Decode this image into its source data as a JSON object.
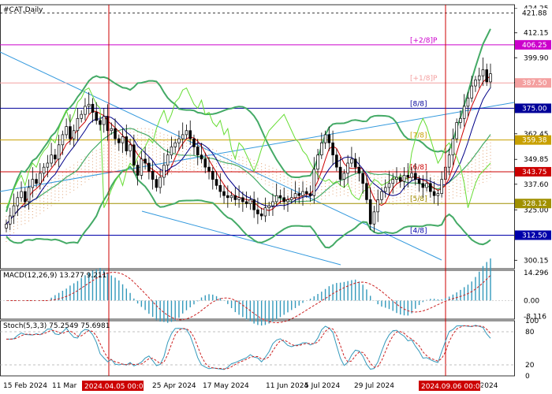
{
  "title": "#CAT,Daily",
  "chart_data": {
    "type": "candlestick",
    "symbol": "#CAT",
    "timeframe": "Daily",
    "price_axis_ticks": [
      "424.25",
      "412.15",
      "399.90",
      "387.70",
      "362.45",
      "349.85",
      "337.60",
      "325.00",
      "300.15"
    ],
    "price_range": [
      296,
      426
    ],
    "date_axis_labels": [
      "15 Feb 2024",
      "11 Mar",
      "25 Apr 2024",
      "17 May 2024",
      "11 Jun 2024",
      "5 Jul 2024",
      "29 Jul 2024",
      "p 2024"
    ],
    "highlighted_dates": [
      "2024.04.05 00:00",
      "2024.09.06 00:00"
    ],
    "murrey_levels": [
      {
        "label": "[+2/8]P",
        "price": 406.25,
        "tag": "406.25",
        "color": "#cc00cc"
      },
      {
        "label": "[+1/8]P",
        "price": 387.5,
        "tag": "387.50",
        "color": "#f4a0a0"
      },
      {
        "label": "[8/8]",
        "price": 375.0,
        "tag": "375.00",
        "color": "#000099"
      },
      {
        "label": "[7/8]",
        "price": 359.38,
        "tag": "359.38",
        "color": "#c8a000"
      },
      {
        "label": "[6/8]",
        "price": 343.75,
        "tag": "343.75",
        "color": "#cc0000"
      },
      {
        "label": "[5/8]",
        "price": 328.12,
        "tag": "328.12",
        "color": "#a09000"
      },
      {
        "label": "[4/8]",
        "price": 312.5,
        "tag": "312.50",
        "color": "#0000aa"
      }
    ],
    "top_level": {
      "price": 421.88,
      "tag": "421.88"
    },
    "last_price": 387.7,
    "close": [
      318,
      322,
      327,
      331,
      334,
      329,
      336,
      340,
      338,
      343,
      346,
      348,
      352,
      350,
      357,
      362,
      366,
      360,
      364,
      370,
      372,
      376,
      377,
      373,
      369,
      367,
      371,
      364,
      365,
      360,
      358,
      361,
      354,
      357,
      347,
      342,
      350,
      348,
      344,
      340,
      336,
      341,
      347,
      352,
      356,
      358,
      360,
      362,
      364,
      360,
      356,
      352,
      350,
      346,
      344,
      340,
      337,
      334,
      332,
      331,
      332,
      330,
      331,
      329,
      328,
      330,
      325,
      323,
      322,
      326,
      327,
      329,
      332,
      331,
      329,
      330,
      331,
      333,
      332,
      334,
      333,
      332,
      345,
      352,
      358,
      362,
      358,
      352,
      346,
      340,
      343,
      348,
      350,
      346,
      343,
      338,
      330,
      318,
      324,
      330,
      334,
      336,
      338,
      340,
      341,
      339,
      342,
      341,
      343,
      340,
      338,
      336,
      338,
      334,
      332,
      333,
      340,
      346,
      352,
      360,
      368,
      370,
      376,
      380,
      386,
      389,
      391,
      394,
      388,
      392
    ],
    "macd": {
      "label": "MACD(12,26,9)",
      "main": "13.277",
      "signal": "9.211",
      "ticks": [
        "14.296",
        "0.00",
        "-8.116"
      ],
      "range": [
        -9.5,
        15.5
      ]
    },
    "stochastic": {
      "label": "Stoch(5,3,3)",
      "k": "75.2549",
      "d": "75.6981",
      "ticks": [
        "100",
        "80",
        "20",
        "0"
      ],
      "levels": [
        80,
        20
      ]
    }
  }
}
